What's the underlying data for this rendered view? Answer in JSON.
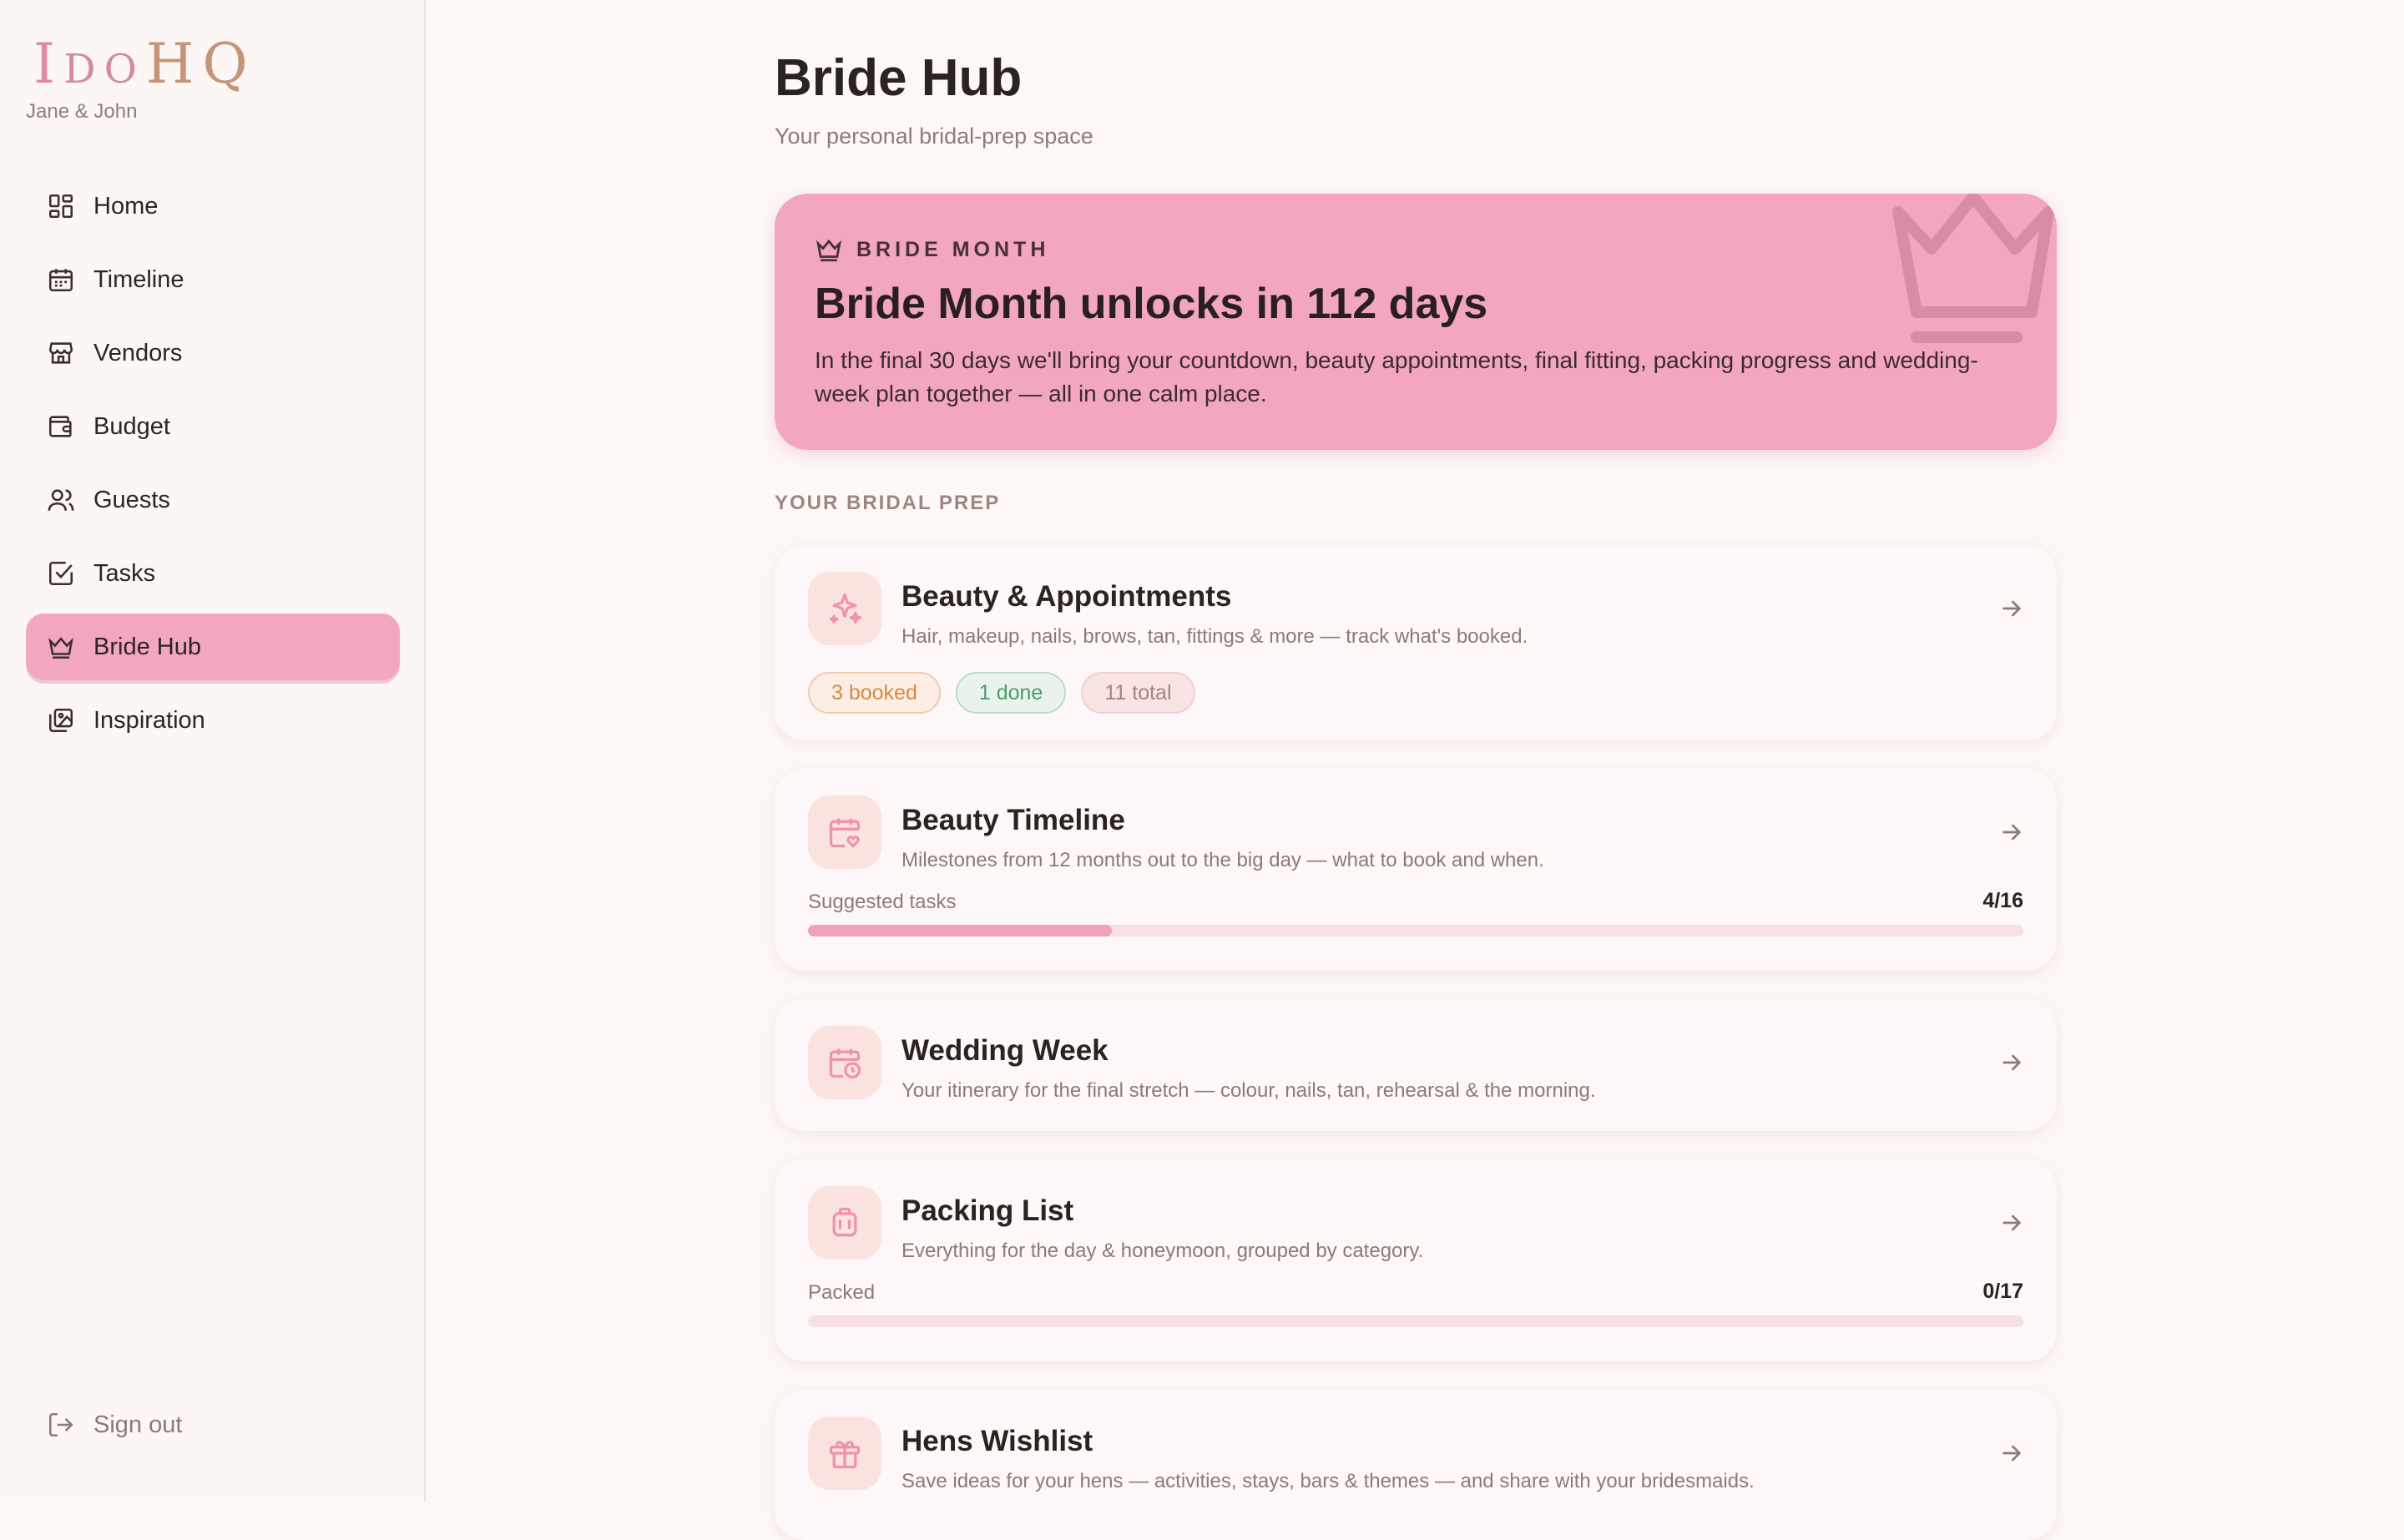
{
  "brand": {
    "logo_i": "I",
    "logo_do": "DO",
    "logo_hq": "HQ",
    "couple": "Jane & John",
    "colors": {
      "pink": "#f2a6bf",
      "gold": "#c69478",
      "background": "#fdf7f6"
    }
  },
  "sidebar": {
    "items": [
      {
        "label": "Home",
        "icon": "dashboard-icon",
        "active": false
      },
      {
        "label": "Timeline",
        "icon": "calendar-icon",
        "active": false
      },
      {
        "label": "Vendors",
        "icon": "store-icon",
        "active": false
      },
      {
        "label": "Budget",
        "icon": "wallet-icon",
        "active": false
      },
      {
        "label": "Guests",
        "icon": "users-icon",
        "active": false
      },
      {
        "label": "Tasks",
        "icon": "checkbox-icon",
        "active": false
      },
      {
        "label": "Bride Hub",
        "icon": "crown-icon",
        "active": true
      },
      {
        "label": "Inspiration",
        "icon": "images-icon",
        "active": false
      }
    ],
    "sign_out": "Sign out"
  },
  "header": {
    "title": "Bride Hub",
    "subtitle": "Your personal bridal-prep space"
  },
  "banner": {
    "eyebrow": "BRIDE MONTH",
    "title": "Bride Month unlocks in 112 days",
    "text": "In the final 30 days we'll bring your countdown, beauty appointments, final fitting, packing progress and wedding-week plan together — all in one calm place."
  },
  "section_label": "YOUR BRIDAL PREP",
  "cards": {
    "beauty": {
      "title": "Beauty & Appointments",
      "desc": "Hair, makeup, nails, brows, tan, fittings & more — track what's booked.",
      "chips": {
        "booked": "3 booked",
        "done": "1 done",
        "total": "11 total"
      }
    },
    "timeline": {
      "title": "Beauty Timeline",
      "desc": "Milestones from 12 months out to the big day — what to book and when.",
      "progress_label": "Suggested tasks",
      "progress_count": "4/16",
      "progress_value": 0.25
    },
    "week": {
      "title": "Wedding Week",
      "desc": "Your itinerary for the final stretch — colour, nails, tan, rehearsal & the morning."
    },
    "packing": {
      "title": "Packing List",
      "desc": "Everything for the day & honeymoon, grouped by category.",
      "progress_label": "Packed",
      "progress_count": "0/17",
      "progress_value": 0
    },
    "hens": {
      "title": "Hens Wishlist",
      "desc": "Save ideas for your hens — activities, stays, bars & themes — and share with your bridesmaids."
    }
  }
}
